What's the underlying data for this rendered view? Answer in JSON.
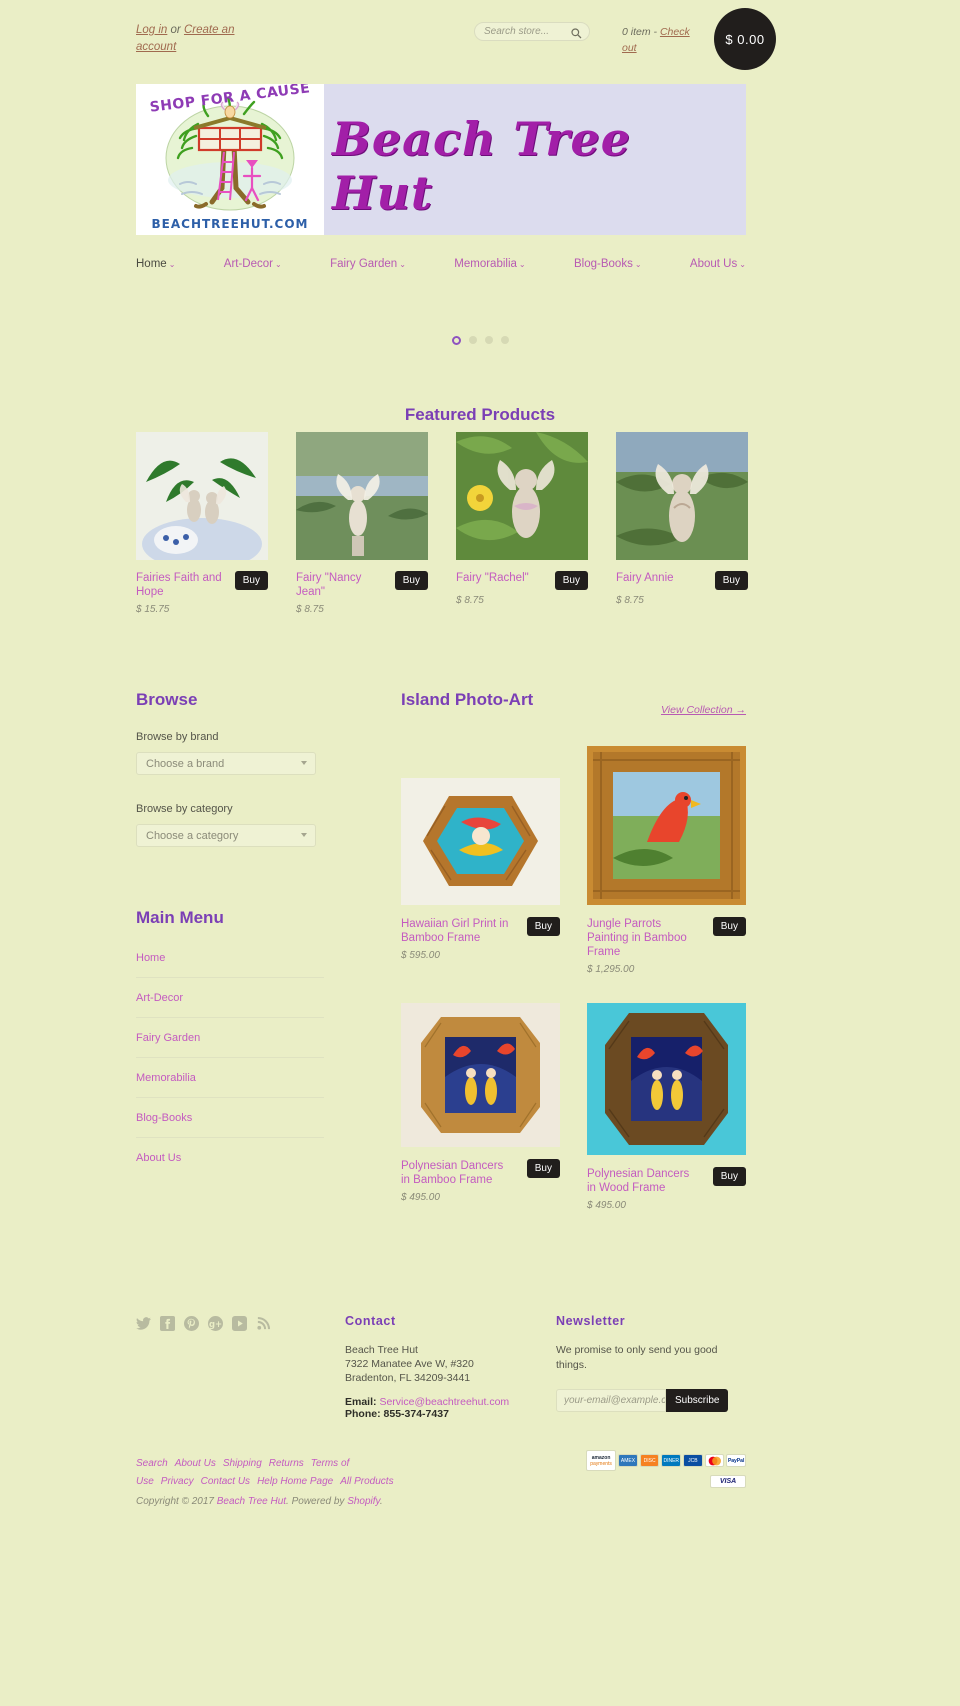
{
  "theme": {
    "bg": "#eaeec6",
    "accent": "#7b3fb5",
    "link": "#c45bc0",
    "dark": "#211e1c",
    "banner_bg": "#dcdcee"
  },
  "topbar": {
    "login_label": "Log in",
    "or_label": " or ",
    "create_account_label": "Create an account",
    "search_placeholder": "Search store...",
    "search_value": "",
    "cart_items": "0 item",
    "cart_sep": " - ",
    "checkout_label": "Check out",
    "cart_total": "$ 0.00"
  },
  "banner": {
    "logo_top_text": "SHOP FOR A CAUSE",
    "logo_bottom_text": "BEACHTREEHUT.COM",
    "store_title": "Beach Tree Hut"
  },
  "nav": {
    "items": [
      {
        "label": "Home",
        "caret": "⌄"
      },
      {
        "label": "Art-Decor",
        "caret": "⌄"
      },
      {
        "label": "Fairy Garden",
        "caret": "⌄"
      },
      {
        "label": "Memorabilia",
        "caret": "⌄"
      },
      {
        "label": "Blog-Books",
        "caret": "⌄"
      },
      {
        "label": "About Us",
        "caret": "⌄"
      }
    ]
  },
  "slider": {
    "dots": 4,
    "active_index": 0
  },
  "featured": {
    "title": "Featured Products",
    "buy_label": "Buy",
    "products": [
      {
        "name": "Fairies Faith and Hope",
        "price": "$ 15.75",
        "buy": "Buy"
      },
      {
        "name": "Fairy \"Nancy Jean\"",
        "price": "$ 8.75",
        "buy": "Buy"
      },
      {
        "name": "Fairy \"Rachel\"",
        "price": "$ 8.75",
        "buy": "Buy"
      },
      {
        "name": "Fairy Annie",
        "price": "$ 8.75",
        "buy": "Buy"
      }
    ]
  },
  "browse": {
    "title": "Browse",
    "brand_label": "Browse by brand",
    "brand_value": "Choose a brand",
    "category_label": "Browse by category",
    "category_value": "Choose a category"
  },
  "main_menu": {
    "title": "Main Menu",
    "items": [
      {
        "label": "Home"
      },
      {
        "label": "Art-Decor"
      },
      {
        "label": "Fairy Garden"
      },
      {
        "label": "Memorabilia"
      },
      {
        "label": "Blog-Books"
      },
      {
        "label": "About Us"
      }
    ]
  },
  "collection": {
    "title": "Island Photo-Art",
    "view_label": "View Collection →",
    "items": [
      {
        "name": "Hawaiian Girl Print in Bamboo Frame",
        "price": "$ 595.00",
        "buy": "Buy"
      },
      {
        "name": "Jungle Parrots Painting in Bamboo Frame",
        "price": "$ 1,295.00",
        "buy": "Buy"
      },
      {
        "name": "Polynesian Dancers in Bamboo Frame",
        "price": "$ 495.00",
        "buy": "Buy"
      },
      {
        "name": "Polynesian Dancers in Wood Frame",
        "price": "$ 495.00",
        "buy": "Buy"
      }
    ]
  },
  "footer": {
    "social": [
      "twitter-icon",
      "facebook-icon",
      "pinterest-icon",
      "googleplus-icon",
      "youtube-icon",
      "rss-icon"
    ],
    "contact": {
      "title": "Contact",
      "name": "Beach Tree Hut",
      "street": "7322 Manatee Ave W, #320",
      "city": "Bradenton, FL 34209-3441",
      "email_label": "Email:",
      "email": "Service@beachtreehut.com",
      "phone_label": "Phone:",
      "phone": "855-374-7437"
    },
    "newsletter": {
      "title": "Newsletter",
      "text": "We promise to only send you good things.",
      "placeholder": "your-email@example.com",
      "value": "",
      "button": "Subscribe"
    },
    "links": [
      "Search",
      "About Us",
      "Shipping",
      "Returns",
      "Terms of Use",
      "Privacy",
      "Contact Us",
      "Help Home Page",
      "All Products"
    ],
    "copyright_prefix": "Copyright © 2017 ",
    "copyright_store": "Beach Tree Hut",
    "copyright_suffix": ". Powered by ",
    "copyright_platform": "Shopify",
    "copyright_end": ".",
    "payments": [
      "amazon payments",
      "american express",
      "discover",
      "diners club",
      "jcb",
      "master",
      "paypal",
      "visa"
    ]
  }
}
